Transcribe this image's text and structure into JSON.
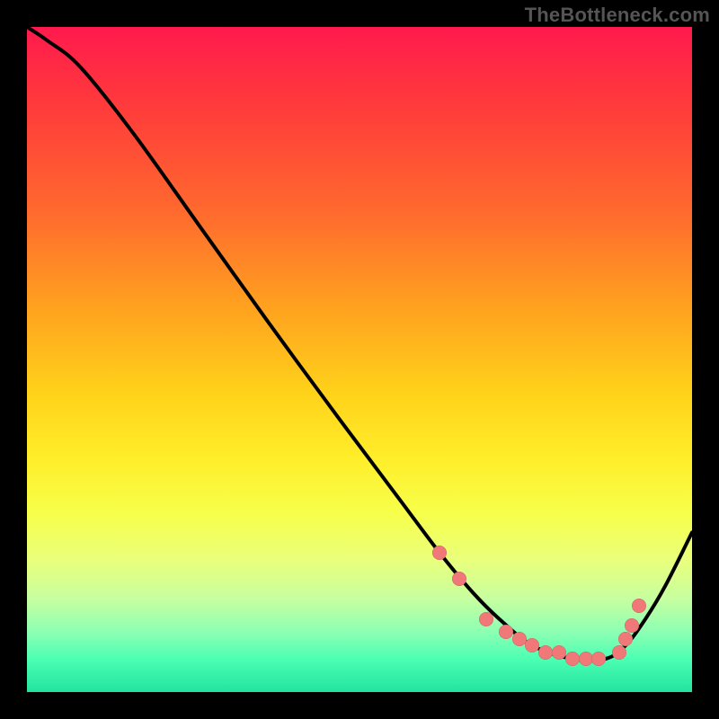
{
  "watermark": "TheBottleneck.com",
  "chart_data": {
    "type": "line",
    "title": "",
    "xlabel": "",
    "ylabel": "",
    "xlim": [
      0,
      100
    ],
    "ylim": [
      0,
      100
    ],
    "grid": false,
    "legend": false,
    "background_gradient": {
      "direction": "vertical",
      "stops": [
        {
          "pos": 0.0,
          "color": "#ff1a4d"
        },
        {
          "pos": 0.12,
          "color": "#ff3b3b"
        },
        {
          "pos": 0.28,
          "color": "#ff6a2e"
        },
        {
          "pos": 0.42,
          "color": "#ffa11f"
        },
        {
          "pos": 0.55,
          "color": "#ffd21a"
        },
        {
          "pos": 0.65,
          "color": "#ffee2a"
        },
        {
          "pos": 0.73,
          "color": "#f7ff4a"
        },
        {
          "pos": 0.8,
          "color": "#eaff7a"
        },
        {
          "pos": 0.86,
          "color": "#c7ffa0"
        },
        {
          "pos": 0.91,
          "color": "#8cffb3"
        },
        {
          "pos": 0.95,
          "color": "#4cffb3"
        },
        {
          "pos": 1.0,
          "color": "#22e3a0"
        }
      ]
    },
    "series": [
      {
        "name": "curve",
        "color": "#000000",
        "x": [
          0,
          3,
          8,
          16,
          26,
          36,
          47,
          56,
          62,
          67,
          71,
          76,
          82,
          87,
          90,
          93,
          96,
          100
        ],
        "y": [
          100,
          98,
          94,
          84,
          70,
          56,
          41,
          29,
          21,
          15,
          11,
          7,
          5,
          5,
          7,
          11,
          16,
          24
        ]
      }
    ],
    "markers": {
      "name": "good-zone-points",
      "color": "#f07878",
      "points": [
        {
          "x": 62,
          "y": 21
        },
        {
          "x": 65,
          "y": 17
        },
        {
          "x": 69,
          "y": 11
        },
        {
          "x": 72,
          "y": 9
        },
        {
          "x": 74,
          "y": 8
        },
        {
          "x": 76,
          "y": 7
        },
        {
          "x": 78,
          "y": 6
        },
        {
          "x": 80,
          "y": 6
        },
        {
          "x": 82,
          "y": 5
        },
        {
          "x": 84,
          "y": 5
        },
        {
          "x": 86,
          "y": 5
        },
        {
          "x": 89,
          "y": 6
        },
        {
          "x": 90,
          "y": 8
        },
        {
          "x": 91,
          "y": 10
        },
        {
          "x": 92,
          "y": 13
        }
      ]
    }
  }
}
